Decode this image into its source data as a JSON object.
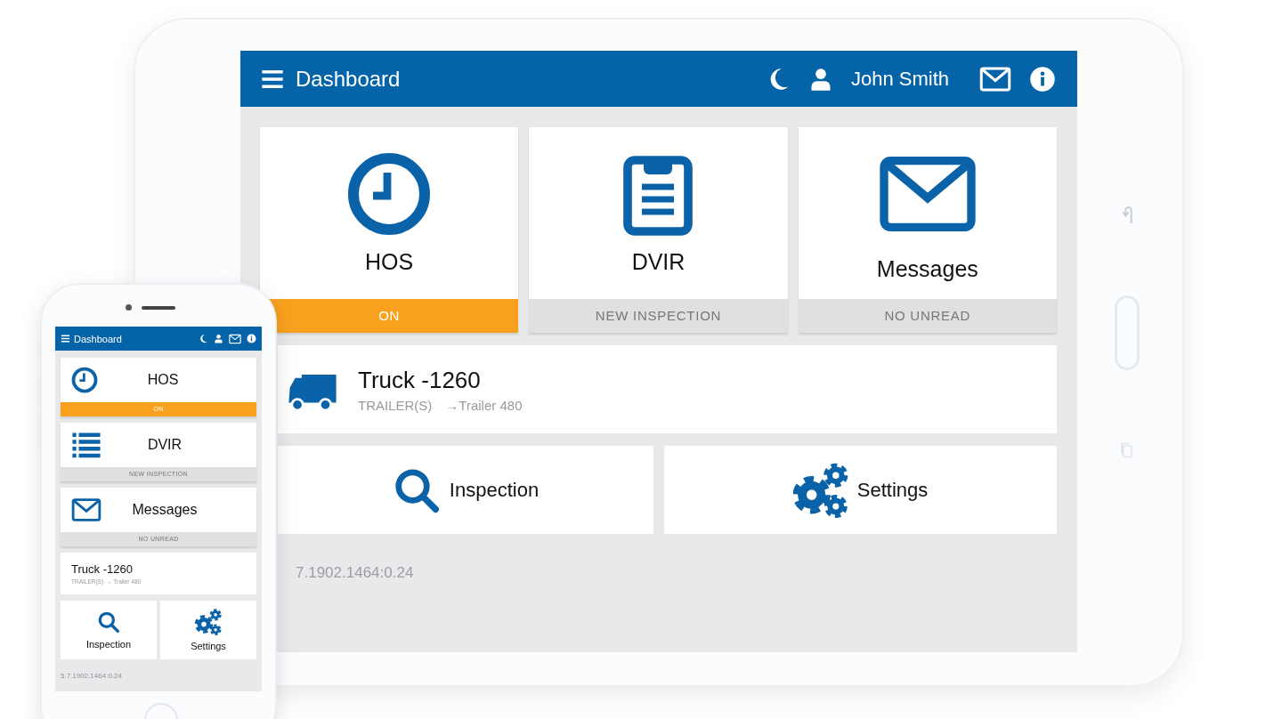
{
  "tablet": {
    "header": {
      "title": "Dashboard",
      "user": "John Smith"
    },
    "tiles": [
      {
        "title": "HOS",
        "status": "ON",
        "active": true
      },
      {
        "title": "DVIR",
        "status": "NEW INSPECTION",
        "active": false
      },
      {
        "title": "Messages",
        "status": "NO UNREAD",
        "active": false
      }
    ],
    "vehicle": {
      "name": "Truck -1260",
      "trailers_label": "TRAILER(S)",
      "trailer": "→Trailer 480"
    },
    "actions": [
      "Inspection",
      "Settings"
    ],
    "version": "7.1902.1464:0.24"
  },
  "phone": {
    "header": {
      "title": "Dashboard"
    },
    "tiles": [
      {
        "title": "HOS",
        "status": "ON",
        "active": true
      },
      {
        "title": "DVIR",
        "status": "NEW INSPECTION",
        "active": false
      },
      {
        "title": "Messages",
        "status": "NO UNREAD",
        "active": false
      }
    ],
    "vehicle": {
      "name": "Truck -1260",
      "trailers_label": "TRAILER(S)",
      "trailer": "→ Trailer 480"
    },
    "actions": [
      "Inspection",
      "Settings"
    ],
    "version": "5.7.1902.1464:0.24"
  }
}
